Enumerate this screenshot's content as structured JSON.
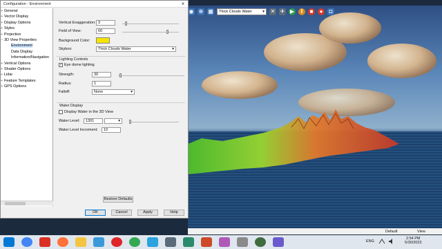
{
  "dialog": {
    "title": "Configuration - Environment",
    "close_glyph": "×"
  },
  "tree": {
    "items": [
      {
        "label": "General",
        "indent": 0,
        "expander": "+"
      },
      {
        "label": "Vector Display",
        "indent": 0,
        "expander": "+"
      },
      {
        "label": "Display Options",
        "indent": 0,
        "expander": "+"
      },
      {
        "label": "Styles",
        "indent": 0,
        "expander": "+"
      },
      {
        "label": "Projection",
        "indent": 0,
        "expander": "+"
      },
      {
        "label": "3D View Properties",
        "indent": 0,
        "expander": "−"
      },
      {
        "label": "Environment",
        "indent": 1,
        "expander": "",
        "selected": true
      },
      {
        "label": "Data Display",
        "indent": 1,
        "expander": ""
      },
      {
        "label": "Information/Navigation",
        "indent": 1,
        "expander": ""
      },
      {
        "label": "Vertical Options",
        "indent": 0,
        "expander": "+"
      },
      {
        "label": "Shader Options",
        "indent": 0,
        "expander": "+"
      },
      {
        "label": "Lidar",
        "indent": 0,
        "expander": "+"
      },
      {
        "label": "Feature Templates",
        "indent": 0,
        "expander": "+"
      },
      {
        "label": "GPS Options",
        "indent": 0,
        "expander": "+"
      }
    ]
  },
  "environment": {
    "vertical_exaggeration_label": "Vertical Exaggeration:",
    "vertical_exaggeration_value": "3",
    "field_of_view_label": "Field of View:",
    "field_of_view_value": "60",
    "background_color_label": "Background Color:",
    "background_color_hex": "#f5e400",
    "skybox_label": "Skybox:",
    "skybox_value": "Thick Clouds Water"
  },
  "lighting": {
    "group_label": "Lighting Controls",
    "eye_dome_label": "Eye dome lighting",
    "eye_dome_checked": true,
    "strength_label": "Strength:",
    "strength_value": "30",
    "radius_label": "Radius:",
    "radius_value": "1",
    "falloff_label": "Falloff:",
    "falloff_value": "None"
  },
  "water": {
    "group_label": "Water Display",
    "display_water_label": "Display Water in the 3D View",
    "display_water_checked": false,
    "level_label": "Water Level:",
    "level_value": "1301",
    "level_unit_value": "",
    "increment_label": "Water Level Increment:",
    "increment_value": "10"
  },
  "buttons": {
    "restore_defaults": "Restore Defaults",
    "ok": "OK",
    "cancel": "Cancel",
    "apply": "Apply",
    "help": "Help"
  },
  "viewer_toolbar": {
    "skybox_select": "Thick Clouds Water"
  },
  "statusbar": {
    "left": "Default",
    "right": "View"
  },
  "taskbar": {
    "language": "ENG",
    "time": "2:54 PM",
    "date": "5/30/2023"
  }
}
